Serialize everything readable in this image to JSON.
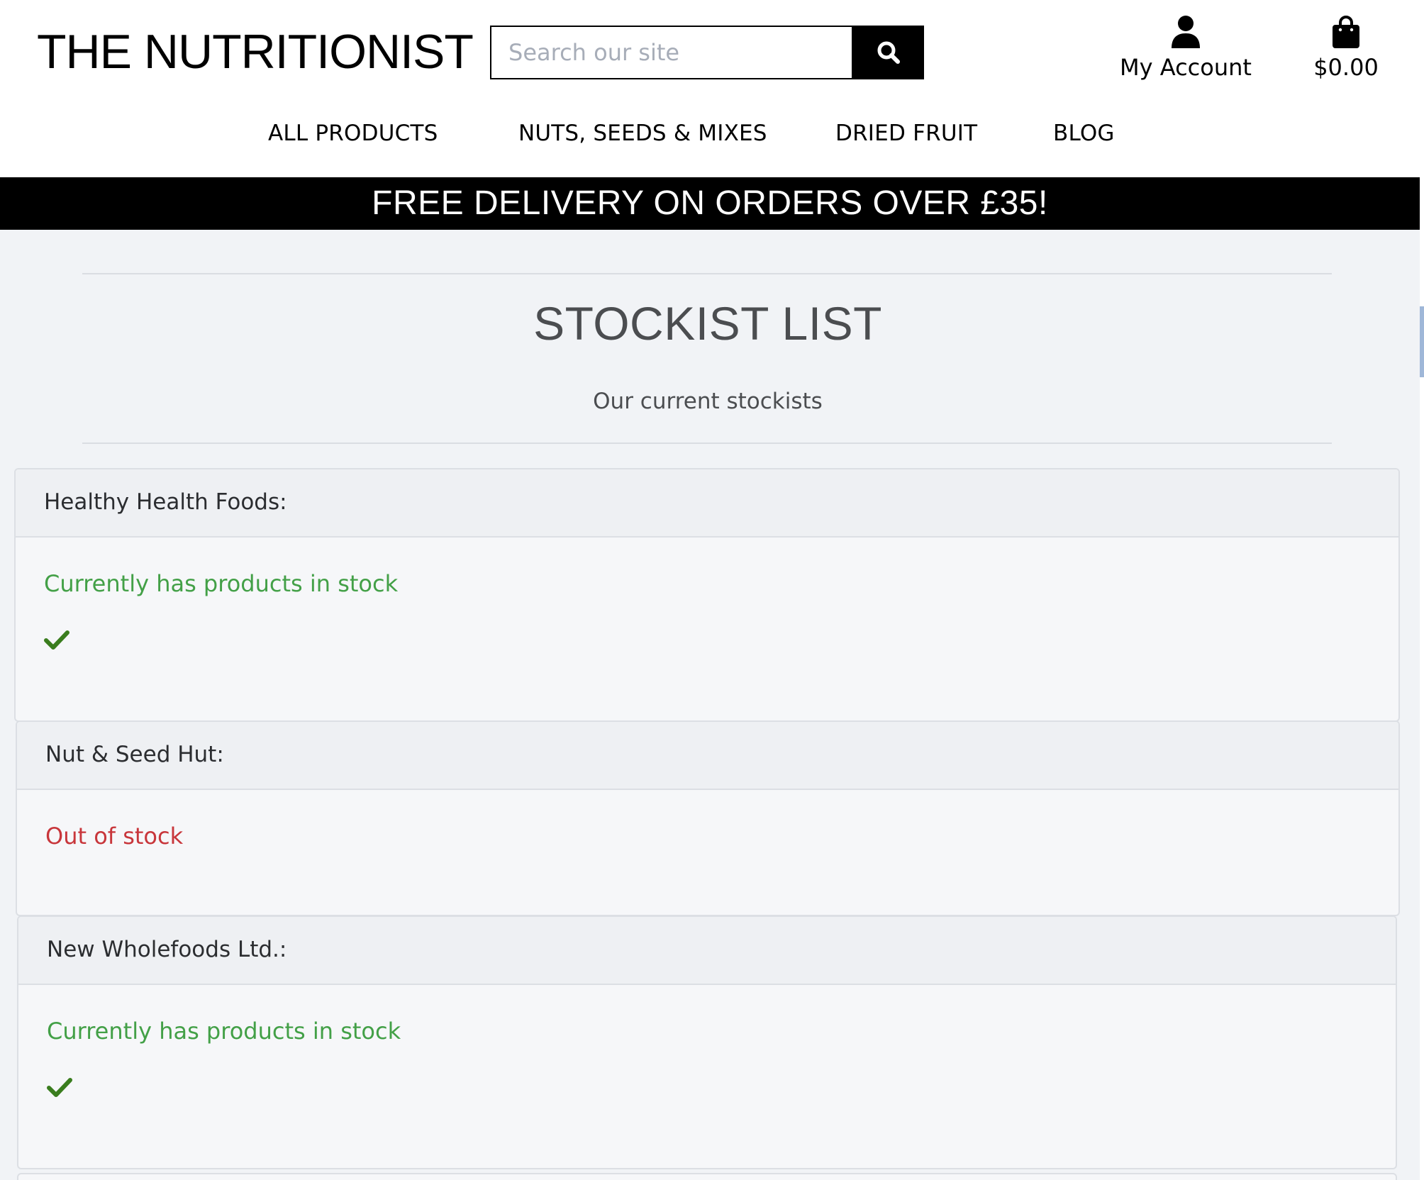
{
  "header": {
    "logo": "THE NUTRITIONIST",
    "search_placeholder": "Search our site",
    "account_label": "My Account",
    "cart_total": "$0.00"
  },
  "nav": {
    "items": [
      "ALL PRODUCTS",
      "NUTS, SEEDS & MIXES",
      "DRIED FRUIT",
      "BLOG"
    ]
  },
  "banner": {
    "text": "FREE DELIVERY ON ORDERS OVER £35!"
  },
  "page": {
    "title": "STOCKIST LIST",
    "subtitle": "Our current stockists"
  },
  "stockists": [
    {
      "name": "Healthy Health Foods:",
      "status": "Currently has products in stock",
      "in_stock": true
    },
    {
      "name": "Nut & Seed Hut:",
      "status": "Out of stock",
      "in_stock": false
    },
    {
      "name": "New Wholefoods Ltd.:",
      "status": "Currently has products in stock",
      "in_stock": true
    }
  ],
  "icons": {
    "search": "search-icon",
    "account": "user-icon",
    "cart": "shopping-bag-icon",
    "in_stock": "check-icon"
  },
  "colors": {
    "banner_bg": "#000000",
    "page_bg": "#f1f3f6",
    "in_stock": "#43a047",
    "out_of_stock": "#c8363b",
    "check": "#3a7d1e"
  }
}
